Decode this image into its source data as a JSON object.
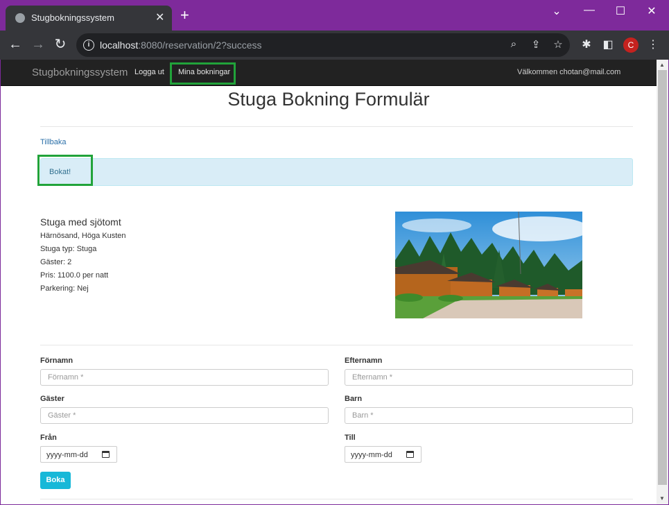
{
  "browser": {
    "tab_title": "Stugbokningssystem",
    "new_tab": "+",
    "url_host": "localhost",
    "url_rest": ":8080/reservation/2?success",
    "profile_initial": "C",
    "window_controls": [
      "chevron-down",
      "minimize",
      "maximize",
      "close"
    ]
  },
  "nav": {
    "brand": "Stugbokningssystem",
    "logout": "Logga ut",
    "my_bookings": "Mina bokningar",
    "welcome": "Välkommen chotan@mail.com"
  },
  "page": {
    "title": "Stuga Bokning Formulär",
    "back": "Tillbaka",
    "alert": "Bokat!"
  },
  "cabin": {
    "name": "Stuga med sjötomt",
    "location": "Härnösand, Höga Kusten",
    "type": "Stuga typ: Stuga",
    "guests": "Gäster: 2",
    "price": "Pris: 1100.0 per natt",
    "parking": "Parkering: Nej"
  },
  "form": {
    "firstname_label": "Förnamn",
    "firstname_placeholder": "Förnamn *",
    "lastname_label": "Efternamn",
    "lastname_placeholder": "Efternamn *",
    "guests_label": "Gäster",
    "guests_placeholder": "Gäster *",
    "children_label": "Barn",
    "children_placeholder": "Barn *",
    "from_label": "Från",
    "from_value": "yyyy-mm-dd",
    "to_label": "Till",
    "to_value": "yyyy-mm-dd",
    "submit": "Boka"
  },
  "colors": {
    "highlight": "#21a33a",
    "button": "#17b8d8",
    "alert_bg": "#d9edf7"
  }
}
